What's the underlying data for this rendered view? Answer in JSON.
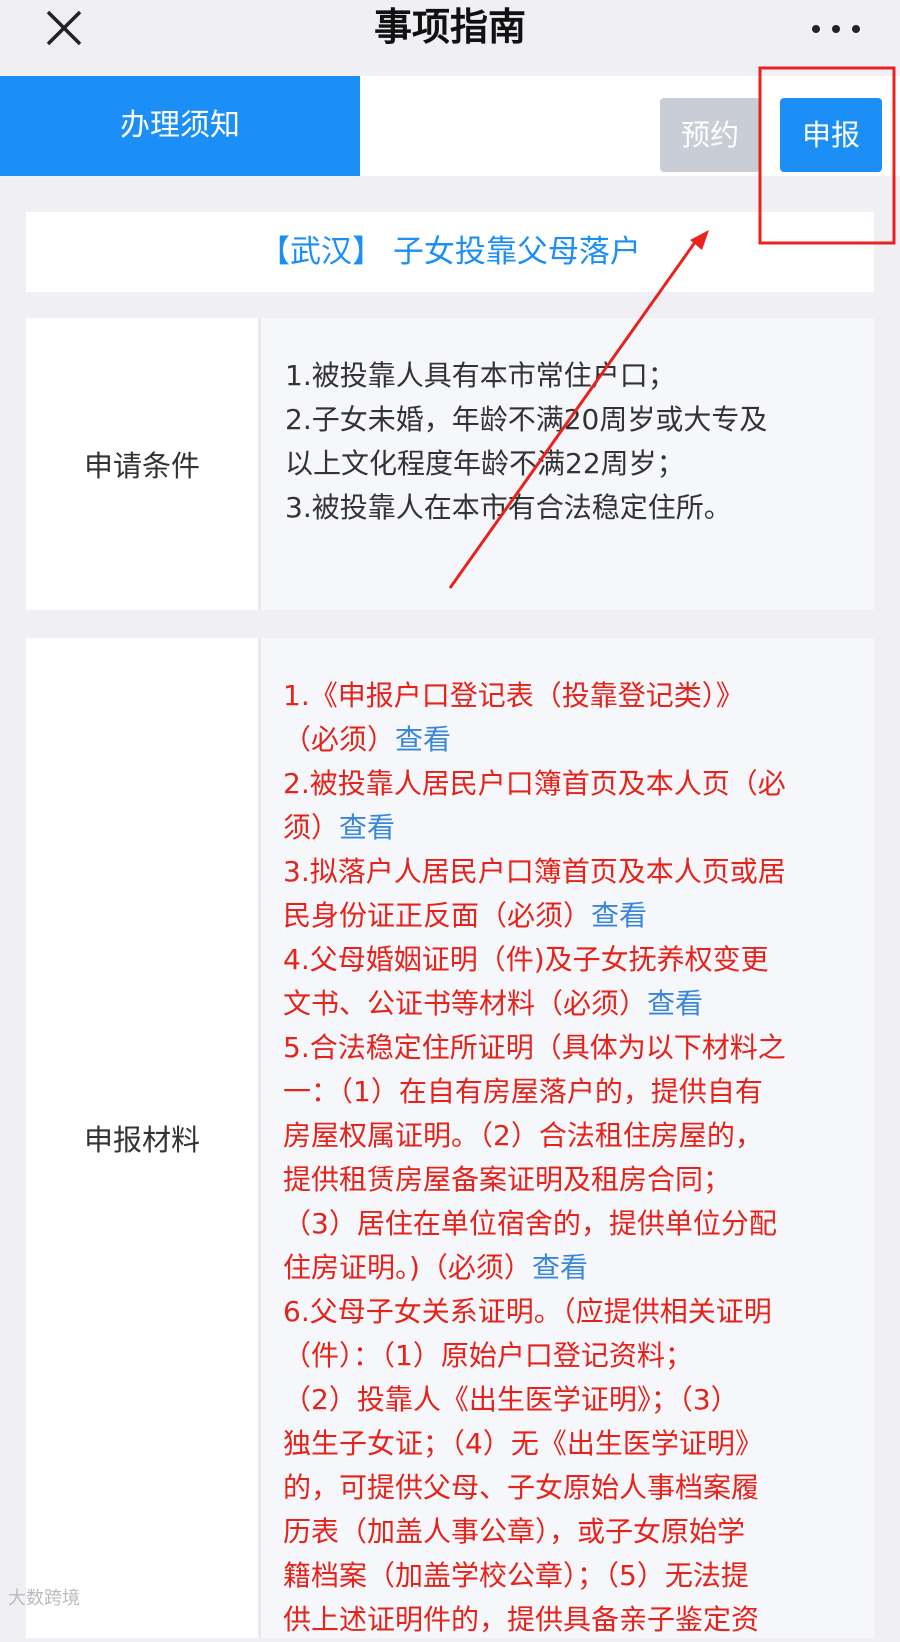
{
  "header": {
    "title": "事项指南",
    "close_icon": "close-icon",
    "more_icon": "more-icon"
  },
  "tabs": {
    "notice_label": "办理须知",
    "appoint_label": "预约",
    "report_label": "申报"
  },
  "service_title": "【武汉】 子女投靠父母落户",
  "conditions": {
    "label": "申请条件",
    "lines": [
      "1.被投靠人具有本市常住户口；",
      "2.子女未婚，年龄不满20周岁或大专及",
      "以上文化程度年龄不满22周岁；",
      "3.被投靠人在本市有合法稳定住所。"
    ]
  },
  "materials": {
    "label": "申报材料",
    "link_text": "查看",
    "lines": [
      {
        "text": "1.《申报户口登记表（投靠登记类）》",
        "link": false
      },
      {
        "text": "（必须）",
        "link": true
      },
      {
        "text": "2.被投靠人居民户口簿首页及本人页（必",
        "link": false
      },
      {
        "text": "须）",
        "link": true
      },
      {
        "text": "3.拟落户人居民户口簿首页及本人页或居",
        "link": false
      },
      {
        "text": "民身份证正反面（必须）",
        "link": true
      },
      {
        "text": "4.父母婚姻证明（件)及子女抚养权变更",
        "link": false
      },
      {
        "text": "文书、公证书等材料（必须）",
        "link": true
      },
      {
        "text": "5.合法稳定住所证明（具体为以下材料之",
        "link": false
      },
      {
        "text": "一：（1）在自有房屋落户的，提供自有",
        "link": false
      },
      {
        "text": "房屋权属证明。（2）合法租住房屋的，",
        "link": false
      },
      {
        "text": "提供租赁房屋备案证明及租房合同；",
        "link": false
      },
      {
        "text": "（3）居住在单位宿舍的，提供单位分配",
        "link": false
      },
      {
        "text": "住房证明。)（必须）",
        "link": true
      },
      {
        "text": "6.父母子女关系证明。（应提供相关证明",
        "link": false
      },
      {
        "text": "（件）：（1）原始户口登记资料；",
        "link": false
      },
      {
        "text": "（2）投靠人《出生医学证明》；（3）",
        "link": false
      },
      {
        "text": "独生子女证；（4）无《出生医学证明》",
        "link": false
      },
      {
        "text": "的，可提供父母、子女原始人事档案履",
        "link": false
      },
      {
        "text": "历表（加盖人事公章），或子女原始学",
        "link": false
      },
      {
        "text": "籍档案（加盖学校公章）；（5）无法提",
        "link": false
      },
      {
        "text": "供上述证明件的，提供具备亲子鉴定资",
        "link": false
      }
    ]
  },
  "watermark": "大数跨境",
  "colors": {
    "accent": "#1b8ff5",
    "required_text": "#e5231a",
    "link": "#3a86d8",
    "annotation": "#e8231f"
  }
}
